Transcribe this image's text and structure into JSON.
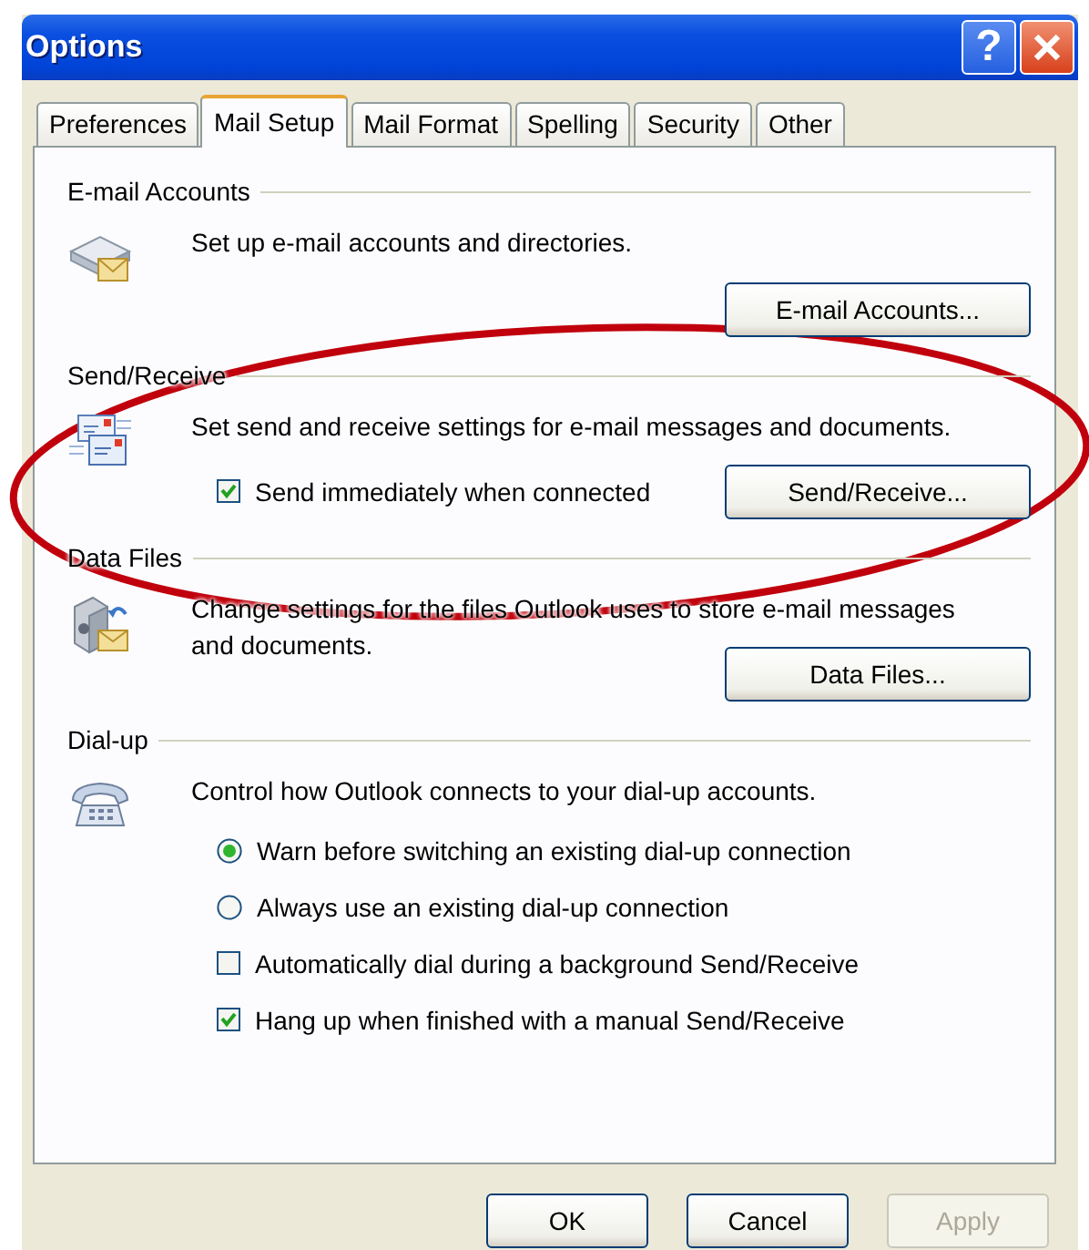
{
  "window": {
    "title": "Options"
  },
  "title_buttons": [
    {
      "kind": "help",
      "label": "?"
    },
    {
      "kind": "close"
    }
  ],
  "tabs": [
    {
      "label": "Preferences",
      "selected": false
    },
    {
      "label": "Mail Setup",
      "selected": true
    },
    {
      "label": "Mail Format",
      "selected": false
    },
    {
      "label": "Spelling",
      "selected": false
    },
    {
      "label": "Security",
      "selected": false
    },
    {
      "label": "Other",
      "selected": false
    }
  ],
  "sections": [
    {
      "kind": "accounts",
      "title": "E-mail Accounts",
      "description": "Set up e-mail accounts and directories.",
      "button": "E-mail Accounts..."
    },
    {
      "kind": "send_receive",
      "title": "Send/Receive",
      "description": "Set send and receive settings for e-mail messages and documents.",
      "options": [
        {
          "kind": "checkbox",
          "label": "Send immediately when connected",
          "checked": true
        }
      ],
      "button": "Send/Receive..."
    },
    {
      "kind": "data_files",
      "title": "Data Files",
      "description": "Change settings for the files Outlook uses to store e-mail messages and documents.",
      "button": "Data Files..."
    },
    {
      "kind": "dial_up",
      "title": "Dial-up",
      "description": "Control how Outlook connects to your dial-up accounts.",
      "options": [
        {
          "kind": "radio",
          "label": "Warn before switching an existing dial-up connection",
          "selected": true
        },
        {
          "kind": "radio",
          "label": "Always use an existing dial-up connection",
          "selected": false
        },
        {
          "kind": "checkbox",
          "label": "Automatically dial during a background Send/Receive",
          "checked": false
        },
        {
          "kind": "checkbox",
          "label": "Hang up when finished with a manual Send/Receive",
          "checked": true
        }
      ]
    }
  ],
  "buttons": [
    {
      "label": "OK",
      "disabled": false
    },
    {
      "label": "Cancel",
      "disabled": false
    },
    {
      "label": "Apply",
      "disabled": true
    }
  ]
}
